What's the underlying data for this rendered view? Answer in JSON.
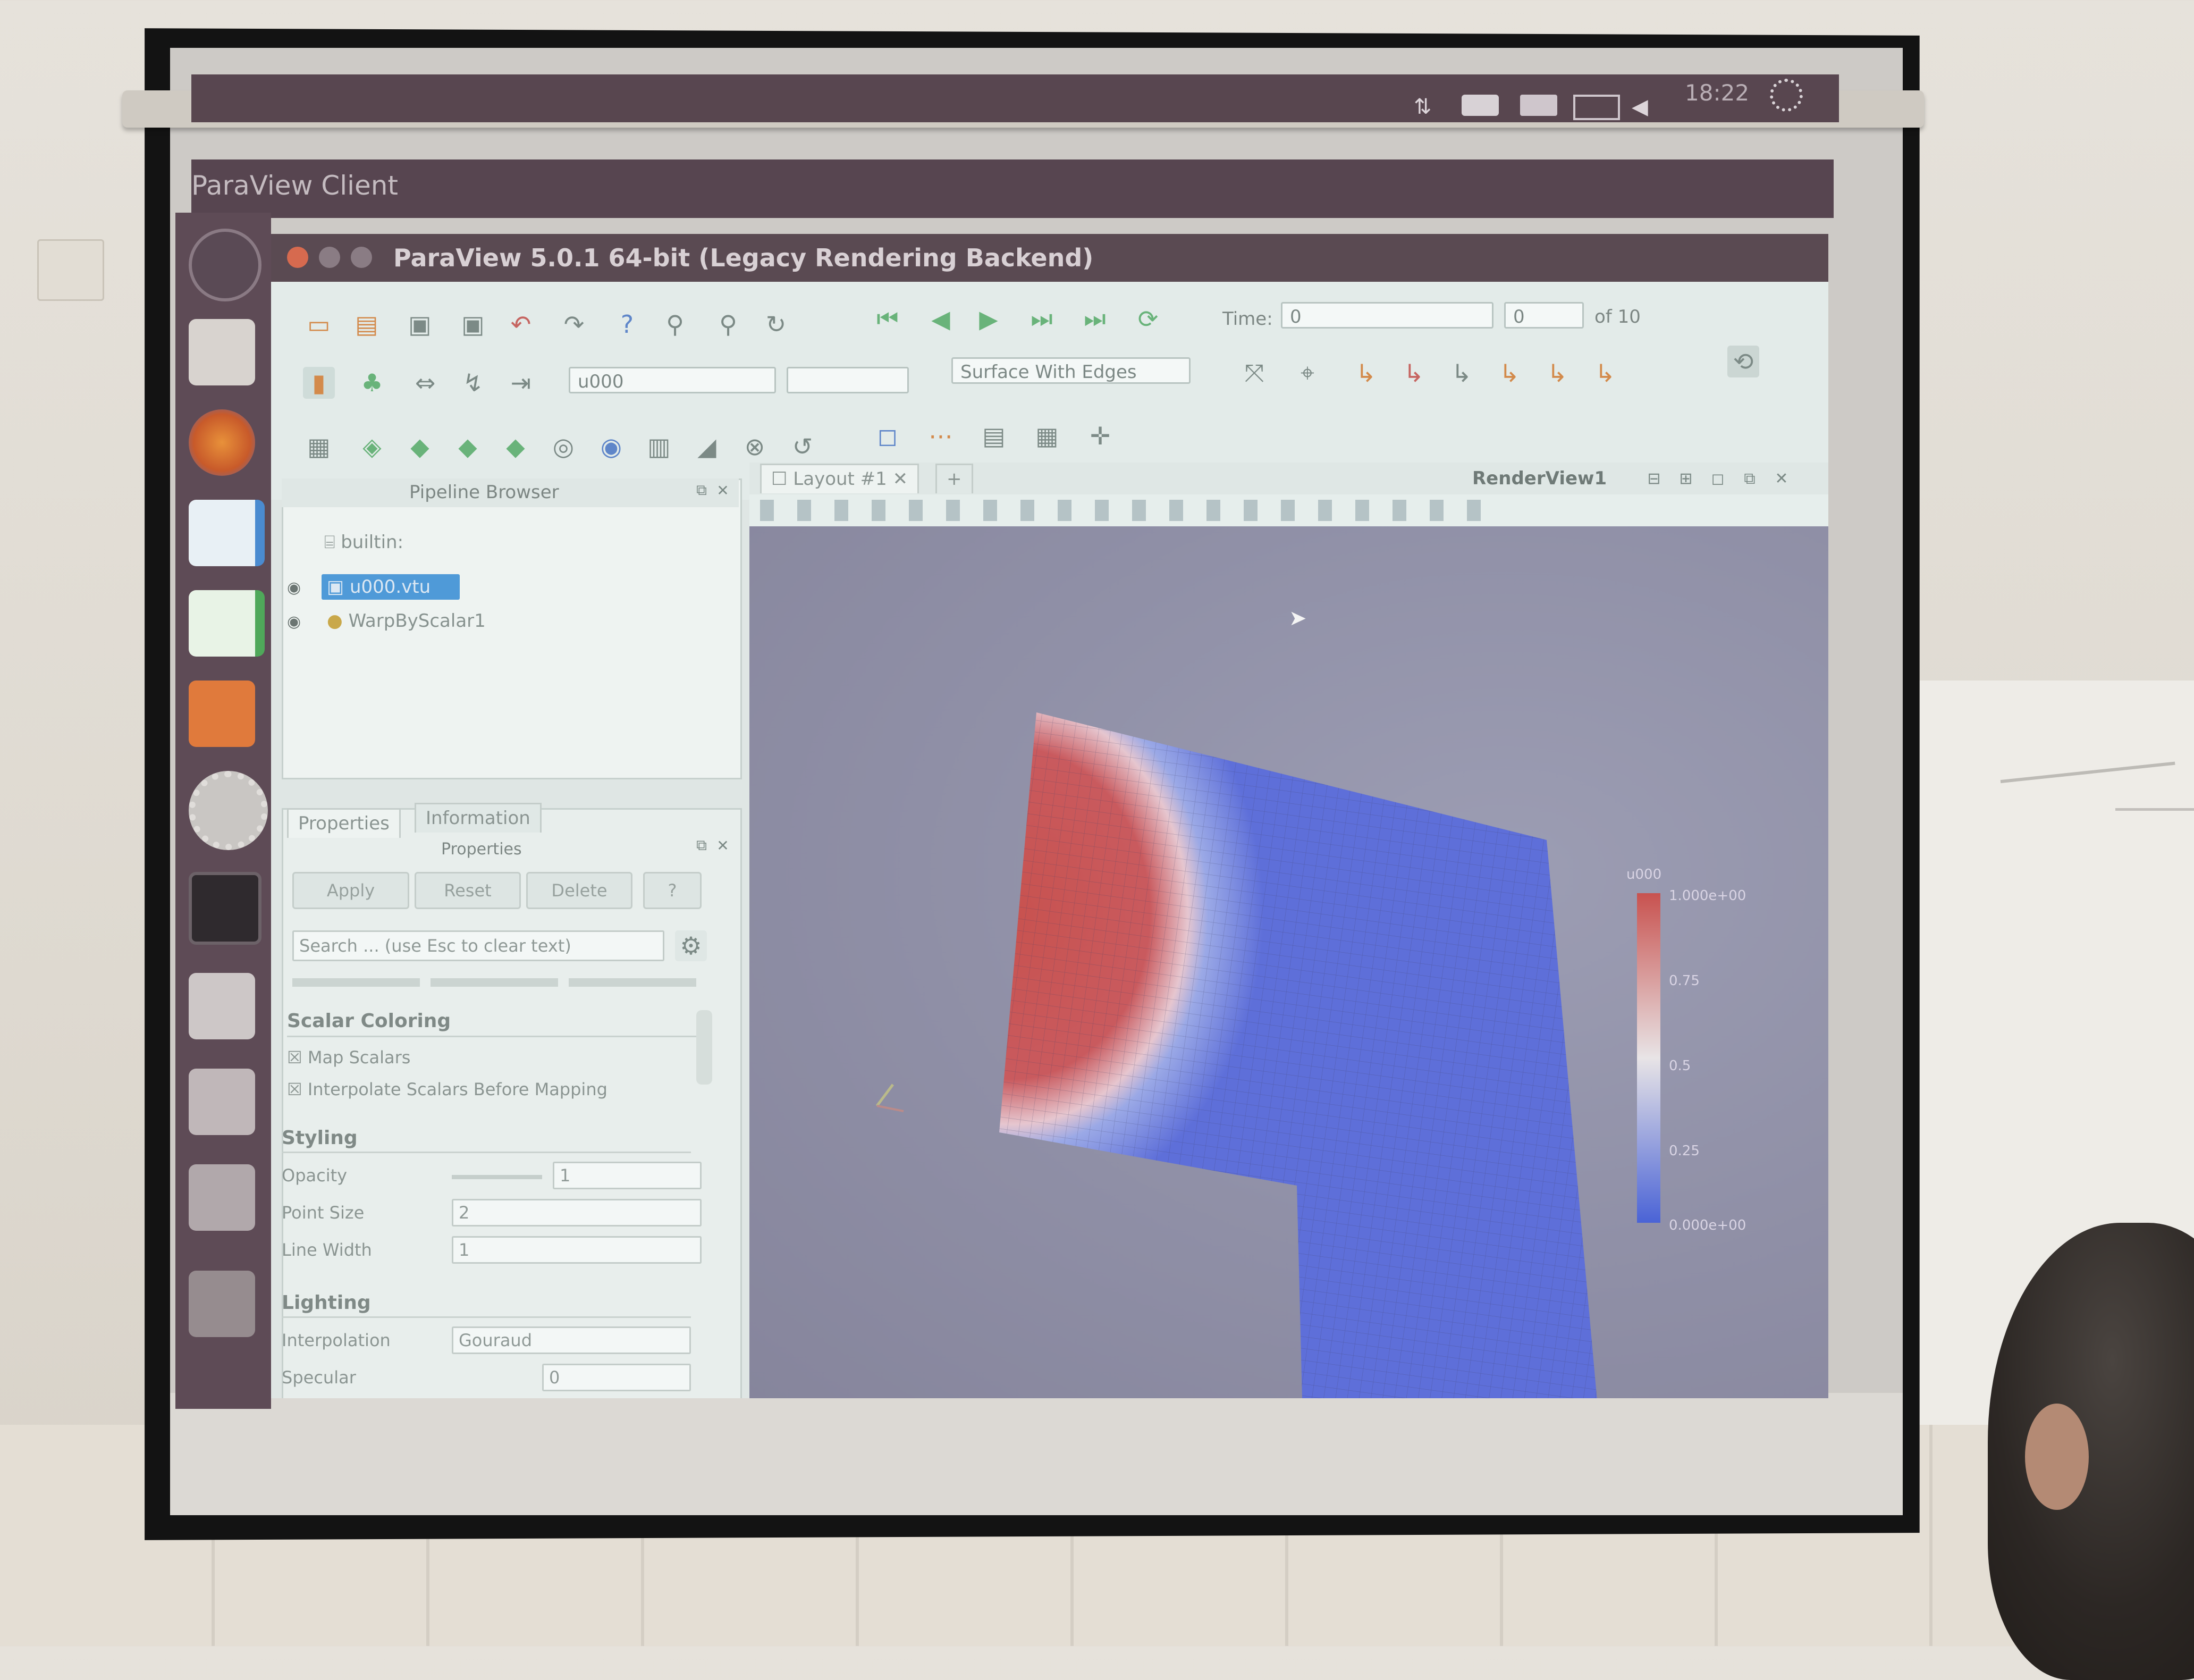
{
  "desktop": {
    "window_title": "ParaView Client",
    "clock": "18:22",
    "tray_icons": [
      "network-icon",
      "keyboard-icon",
      "mail-icon",
      "battery-icon",
      "volume-icon"
    ],
    "launcher_icons": [
      "ubuntu-icon",
      "files-icon",
      "firefox-icon",
      "writer-icon",
      "calc-icon",
      "software-center-icon",
      "settings-icon",
      "terminal-icon",
      "workspace-icon",
      "workspace-icon",
      "workspace-icon",
      "trash-icon"
    ]
  },
  "paraview": {
    "title": "ParaView 5.0.1 64-bit (Legacy Rendering Backend)",
    "time": {
      "label": "Time:",
      "value": "0",
      "step": "0",
      "of_text": "of 10"
    },
    "active_array": "u000",
    "component": "",
    "representation": "Surface With Edges",
    "pipeline": {
      "header": "Pipeline Browser",
      "items": [
        {
          "label": "builtin:",
          "selected": false
        },
        {
          "label": "u000.vtu",
          "selected": true
        },
        {
          "label": "WarpByScalar1",
          "selected": false
        }
      ]
    },
    "properties": {
      "tabs": [
        "Properties",
        "Information"
      ],
      "header": "Properties",
      "buttons": [
        "Apply",
        "Reset",
        "Delete",
        "?"
      ],
      "search_placeholder": "Search ... (use Esc to clear text)",
      "sections": {
        "scalar_coloring": {
          "title": "Scalar Coloring",
          "checkboxes": [
            "Map Scalars",
            "Interpolate Scalars Before Mapping"
          ]
        },
        "styling": {
          "title": "Styling",
          "rows": [
            {
              "label": "Opacity",
              "value": "1"
            },
            {
              "label": "Point Size",
              "value": "2"
            },
            {
              "label": "Line Width",
              "value": "1"
            }
          ]
        },
        "lighting": {
          "title": "Lighting",
          "rows": [
            {
              "label": "Interpolation",
              "value": "Gouraud"
            },
            {
              "label": "Specular",
              "value": "0"
            }
          ]
        }
      }
    },
    "layout_tab": "Layout #1",
    "add_tab": "+",
    "render_view_name": "RenderView1",
    "color_legend": {
      "title": "u000",
      "max": "1.000e+00",
      "ticks": [
        "0.75",
        "0.5",
        "0.25"
      ],
      "min": "0.000e+00",
      "colors": {
        "high": "#c8524f",
        "mid": "#e8e4e6",
        "low": "#4a63d6"
      }
    }
  }
}
